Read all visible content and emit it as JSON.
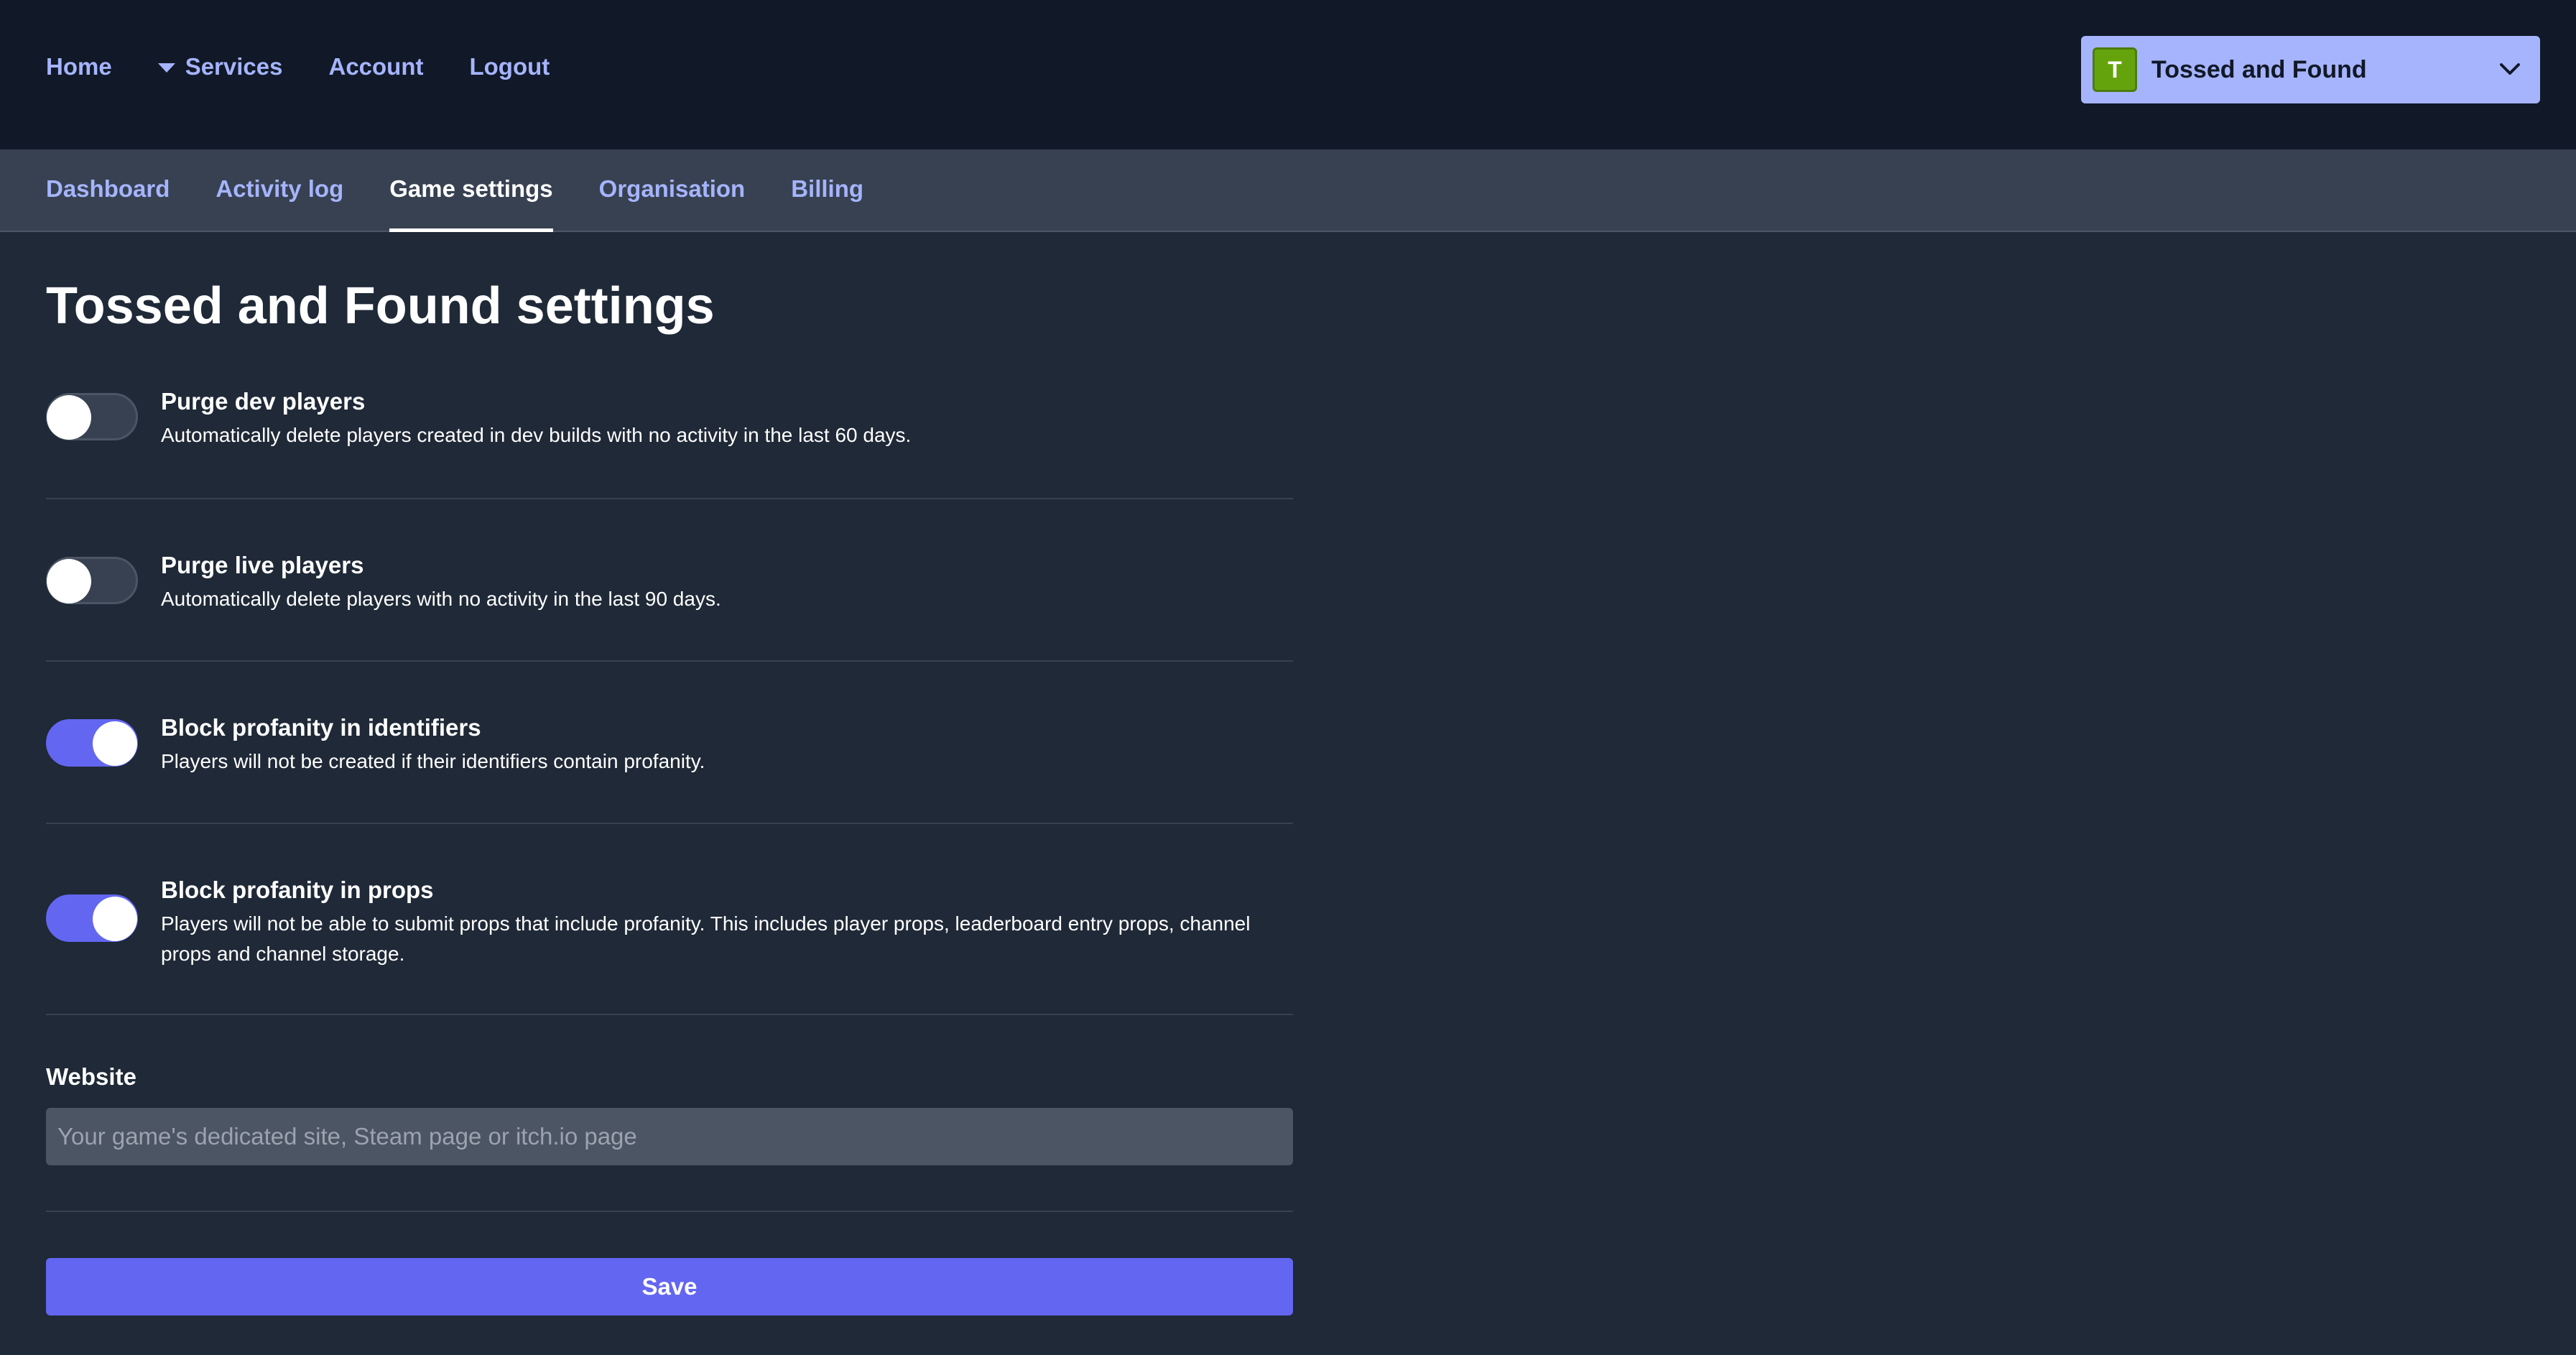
{
  "top_nav": {
    "items": [
      "Home",
      "Services",
      "Account",
      "Logout"
    ]
  },
  "game_selector": {
    "avatar_letter": "T",
    "name": "Tossed and Found",
    "icon": "chevron-down-icon"
  },
  "sub_nav": {
    "tabs": [
      {
        "label": "Dashboard",
        "active": false
      },
      {
        "label": "Activity log",
        "active": false
      },
      {
        "label": "Game settings",
        "active": true
      },
      {
        "label": "Organisation",
        "active": false
      },
      {
        "label": "Billing",
        "active": false
      }
    ]
  },
  "page": {
    "title": "Tossed and Found settings",
    "settings": [
      {
        "label": "Purge dev players",
        "description": "Automatically delete players created in dev builds with no activity in the last 60 days.",
        "enabled": false
      },
      {
        "label": "Purge live players",
        "description": "Automatically delete players with no activity in the last 90 days.",
        "enabled": false
      },
      {
        "label": "Block profanity in identifiers",
        "description": "Players will not be created if their identifiers contain profanity.",
        "enabled": true
      },
      {
        "label": "Block profanity in props",
        "description": "Players will not be able to submit props that include profanity. This includes player props, leaderboard entry props, channel props and channel storage.",
        "enabled": true
      }
    ],
    "website": {
      "label": "Website",
      "value": "",
      "placeholder": "Your game's dedicated site, Steam page or itch.io page"
    },
    "save_label": "Save"
  },
  "colors": {
    "background": "#1f2937",
    "header": "#111827",
    "subnav": "#374151",
    "accent": "#6366f1",
    "link": "#a5b4fc",
    "avatar": "#65a30d"
  }
}
